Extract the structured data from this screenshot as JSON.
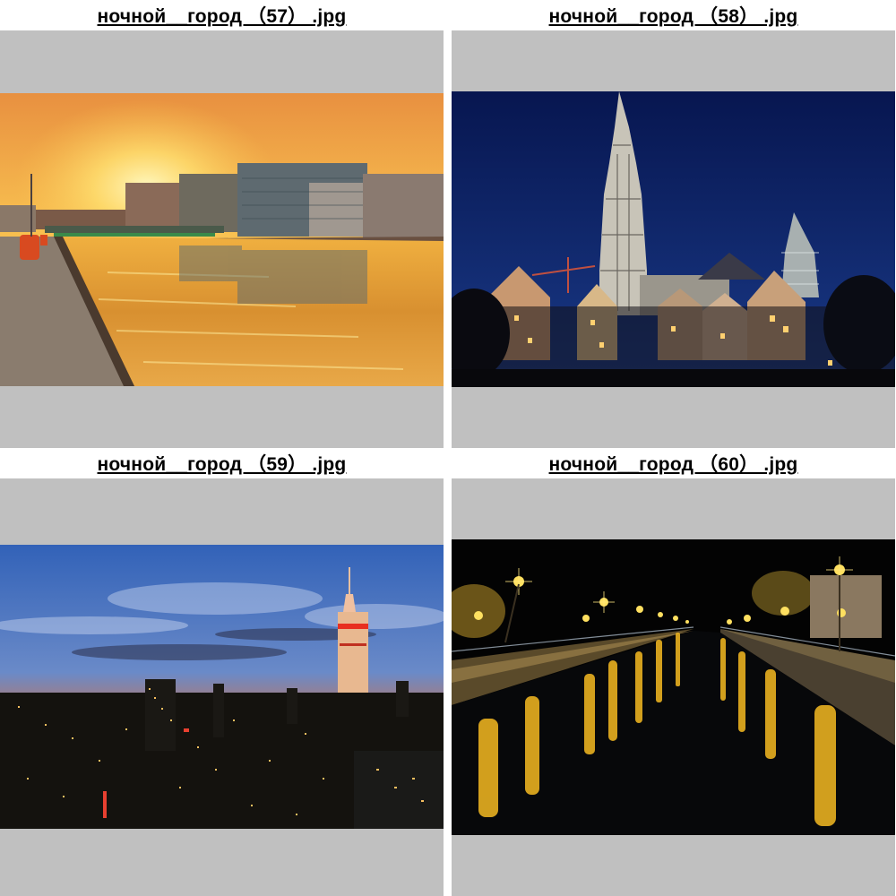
{
  "thumbnails": [
    {
      "filename": "ночной__город （57） .jpg",
      "colors": {
        "sky_top": "#f0a040",
        "sun": "#ffe070",
        "water": "#e0a040"
      }
    },
    {
      "filename": "ночной__город （58） .jpg",
      "colors": {
        "sky": "#0a1c5a",
        "spire": "#c8c4b8",
        "lights": "#ffd070"
      }
    },
    {
      "filename": "ночной__город （59） .jpg",
      "colors": {
        "sky_top": "#3a68b8",
        "horizon": "#e8602a",
        "tower": "#f8d0a0"
      }
    },
    {
      "filename": "ночной__город （60） .jpg",
      "colors": {
        "sky": "#020202",
        "lamps": "#ffd040",
        "reflection": "#e8b020"
      }
    }
  ]
}
